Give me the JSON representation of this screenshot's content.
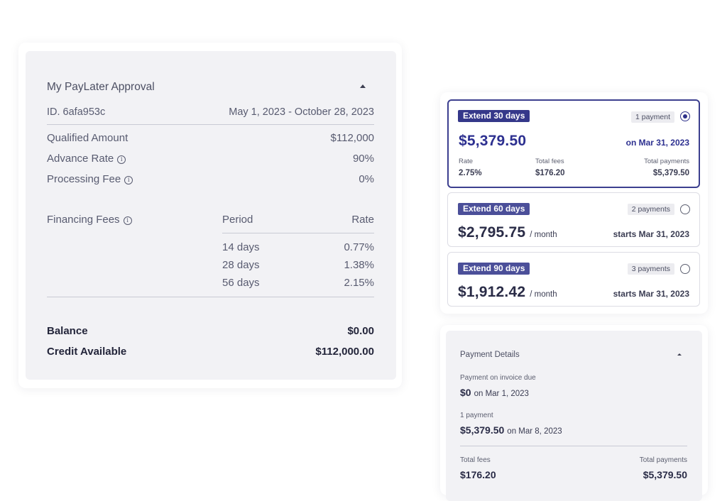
{
  "approval": {
    "title": "My PayLater Approval",
    "id_label": "ID. 6afa953c",
    "date_range": "May 1, 2023 - October 28, 2023",
    "qualified_amount": {
      "label": "Qualified Amount",
      "value": "$112,000"
    },
    "advance_rate": {
      "label": "Advance Rate",
      "value": "90%"
    },
    "processing_fee": {
      "label": "Processing Fee",
      "value": "0%"
    },
    "financing": {
      "label": "Financing Fees",
      "period_header": "Period",
      "rate_header": "Rate",
      "rows": [
        {
          "period": "14 days",
          "rate": "0.77%"
        },
        {
          "period": "28 days",
          "rate": "1.38%"
        },
        {
          "period": "56 days",
          "rate": "2.15%"
        }
      ]
    },
    "balance": {
      "label": "Balance",
      "value": "$0.00"
    },
    "credit_available": {
      "label": "Credit Available",
      "value": "$112,000.00"
    }
  },
  "extend_options": [
    {
      "pill": "Extend 30 days",
      "payments": "1 payment",
      "selected": true,
      "amount": "$5,379.50",
      "unit": "",
      "when": "on Mar 31, 2023",
      "rate_label": "Rate",
      "rate_value": "2.75%",
      "fees_label": "Total fees",
      "fees_value": "$176.20",
      "total_label": "Total payments",
      "total_value": "$5,379.50"
    },
    {
      "pill": "Extend 60 days",
      "payments": "2 payments",
      "selected": false,
      "amount": "$2,795.75",
      "unit": "/ month",
      "when": "starts Mar 31, 2023"
    },
    {
      "pill": "Extend 90 days",
      "payments": "3 payments",
      "selected": false,
      "amount": "$1,912.42",
      "unit": "/ month",
      "when": "starts Mar 31, 2023"
    }
  ],
  "payment_details": {
    "title": "Payment Details",
    "invoice_due_label": "Payment on invoice due",
    "invoice_due_amount": "$0",
    "invoice_due_date": "on Mar 1, 2023",
    "payment_label": "1 payment",
    "payment_amount": "$5,379.50",
    "payment_date": "on Mar 8, 2023",
    "total_fees_label": "Total fees",
    "total_fees_value": "$176.20",
    "total_payments_label": "Total payments",
    "total_payments_value": "$5,379.50"
  },
  "colors": {
    "accent": "#35388a",
    "pill": "#4b4f99",
    "panel": "#f2f2f5"
  }
}
